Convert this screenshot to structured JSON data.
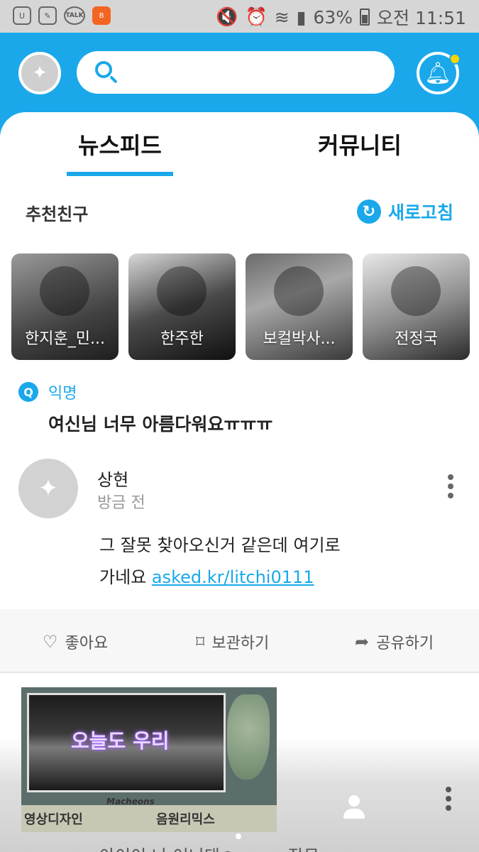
{
  "status_bar": {
    "talk_label": "TALK",
    "battery": "63%",
    "time": "오전 11:51"
  },
  "tabs": [
    {
      "label": "뉴스피드"
    },
    {
      "label": "커뮤니티"
    }
  ],
  "recommend": {
    "title": "추천친구",
    "refresh_label": "새로고침",
    "friends": [
      {
        "name": "한지훈_민..."
      },
      {
        "name": "한주한"
      },
      {
        "name": "보컬박사..."
      },
      {
        "name": "전정국"
      }
    ]
  },
  "post": {
    "badge": "Q",
    "author": "익명",
    "question": "여신님 너무 아름다워요ㅠㅠㅠ",
    "answer": {
      "name": "상현",
      "time": "방금 전",
      "text_line1": "그 잘못 찾아오신거 같은데 여기로",
      "text_line2_prefix": "가네요",
      "link": "asked.kr/litchi0111"
    },
    "actions": {
      "like": "좋아요",
      "save": "보관하기",
      "share": "공유하기"
    }
  },
  "overlay": {
    "video_title": "오늘도 우리",
    "caption": "Macheons",
    "bottom_left": "영상디자인",
    "bottom_right": "음원리믹스"
  },
  "next_post_text": "아이이 나 어니댄ㅇㅠㅠㅠ 작무"
}
